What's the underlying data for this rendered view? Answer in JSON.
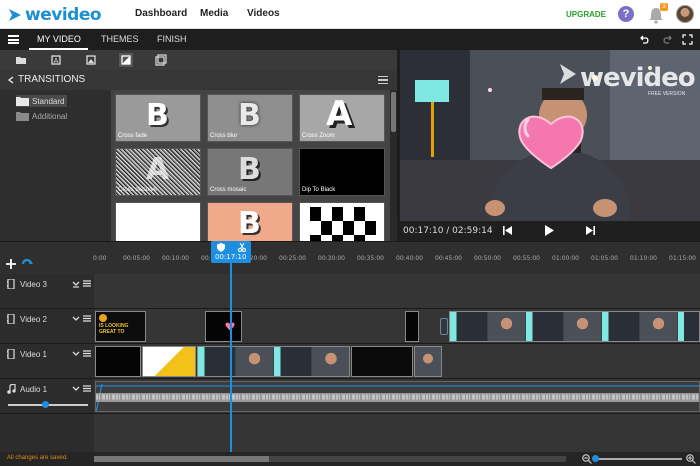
{
  "brand": {
    "logo_text": "wevideo",
    "accent": "#1d8fd4"
  },
  "topnav": {
    "links": [
      "Dashboard",
      "Media",
      "Videos"
    ],
    "upgrade_label": "UPGRADE",
    "help_label": "?",
    "notification_count": "3"
  },
  "editor_tabs": {
    "tabs": [
      "MY VIDEO",
      "THEMES",
      "FINISH"
    ],
    "active": "MY VIDEO"
  },
  "panel": {
    "back_title": "TRANSITIONS",
    "folders": [
      "Standard",
      "Additional"
    ],
    "selected_folder": "Standard",
    "transitions": [
      "Cross fade",
      "Cross blur",
      "Cross Zoom",
      "Cross dissolve",
      "Cross mosaic",
      "Dip To Black"
    ]
  },
  "preview": {
    "watermark": "wevideo",
    "watermark_sub": "FREE VERSION",
    "timecode": "00:17:10 / 02:59:14"
  },
  "timeline": {
    "playhead_time": "00:17:10",
    "ruler_ticks": [
      "0:00",
      "00:05:00",
      "00:10:00",
      "00:15:00",
      "00:20:00",
      "00:25:00",
      "00:30:00",
      "00:35:00",
      "00:40:00",
      "00:45:00",
      "00:50:00",
      "00:55:00",
      "01:00:00",
      "01:05:00",
      "01:10:00",
      "01:15:00"
    ],
    "tracks": [
      "Video 3",
      "Video 2",
      "Video 1",
      "Audio 1"
    ],
    "title_clip_text": "IS LOOKING GREAT TO"
  },
  "status": {
    "saved_text": "All changes are saved."
  }
}
